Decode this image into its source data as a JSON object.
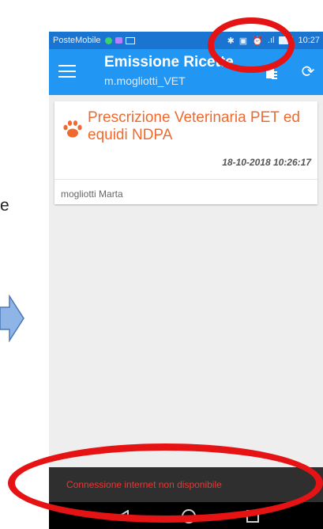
{
  "slide": {
    "letter": "e"
  },
  "status_bar": {
    "carrier": "PosteMobile",
    "time": "10:27",
    "signal": ".ıl"
  },
  "app_bar": {
    "title": "Emissione Ricette",
    "subtitle": "m.mogliotti_VET"
  },
  "card": {
    "title": "Prescrizione Veterinaria PET ed equidi NDPA",
    "date": "18-10-2018 10:26:17",
    "user": "mogliotti Marta"
  },
  "fab": {
    "label": "+"
  },
  "snackbar": {
    "message": "Connessione internet non disponibile"
  },
  "colors": {
    "app_bar": "#2196f3",
    "status_bar": "#1a75d2",
    "card_title": "#ef6a2e",
    "snackbar_text": "#e53935",
    "annotation": "#e51313",
    "fab": "#3f8ef3"
  }
}
